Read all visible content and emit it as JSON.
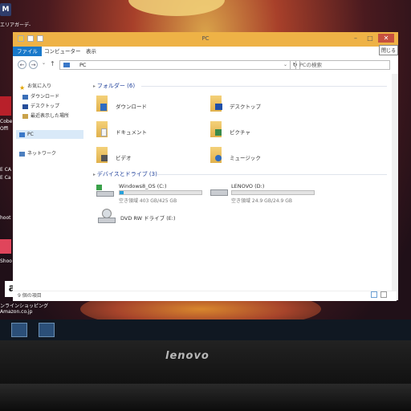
{
  "window": {
    "title": "PC",
    "tooltip": "閉じる",
    "controls": {
      "minimize": "–",
      "maximize": "□",
      "close": "✕"
    }
  },
  "ribbon": {
    "tabs": [
      "ファイル",
      "コンピューター",
      "表示"
    ]
  },
  "address": {
    "back": "←",
    "forward": "→",
    "up": "↑",
    "path": "PC",
    "dropdown": "⌄",
    "refresh": "↻",
    "search_placeholder": "PCの検索"
  },
  "nav": {
    "favorites": "お気に入り",
    "downloads": "ダウンロード",
    "desktop": "デスクトップ",
    "recent": "最近表示した場所",
    "pc": "PC",
    "network": "ネットワーク"
  },
  "folders": {
    "header": "フォルダー (6)",
    "items": [
      "ダウンロード",
      "デスクトップ",
      "ドキュメント",
      "ピクチャ",
      "ビデオ",
      "ミュージック"
    ]
  },
  "drives": {
    "header": "デバイスとドライブ (3)",
    "items": [
      {
        "name": "Windows8_OS (C:)",
        "free": "空き領域 403 GB/425 GB",
        "used_fraction": 0.05
      },
      {
        "name": "LENOVO (D:)",
        "free": "空き領域 24.9 GB/24.9 GB",
        "used_fraction": 0.0
      },
      {
        "name": "DVD RW ドライブ (E:)"
      }
    ]
  },
  "status": "9 個の項目",
  "desktop": {
    "icons": [
      "エリアガーデ-",
      "Cobe",
      "Offi",
      "E CA",
      "E Ca",
      "hoot",
      "Shoo",
      "ンラインショッピング",
      "Amazon.co.jp"
    ]
  },
  "bezel": {
    "brand": "lenovo"
  },
  "colors": {
    "accent": "#1979ca",
    "frame": "#eeb246",
    "close": "#c7503f",
    "bar": "#26a0da"
  }
}
